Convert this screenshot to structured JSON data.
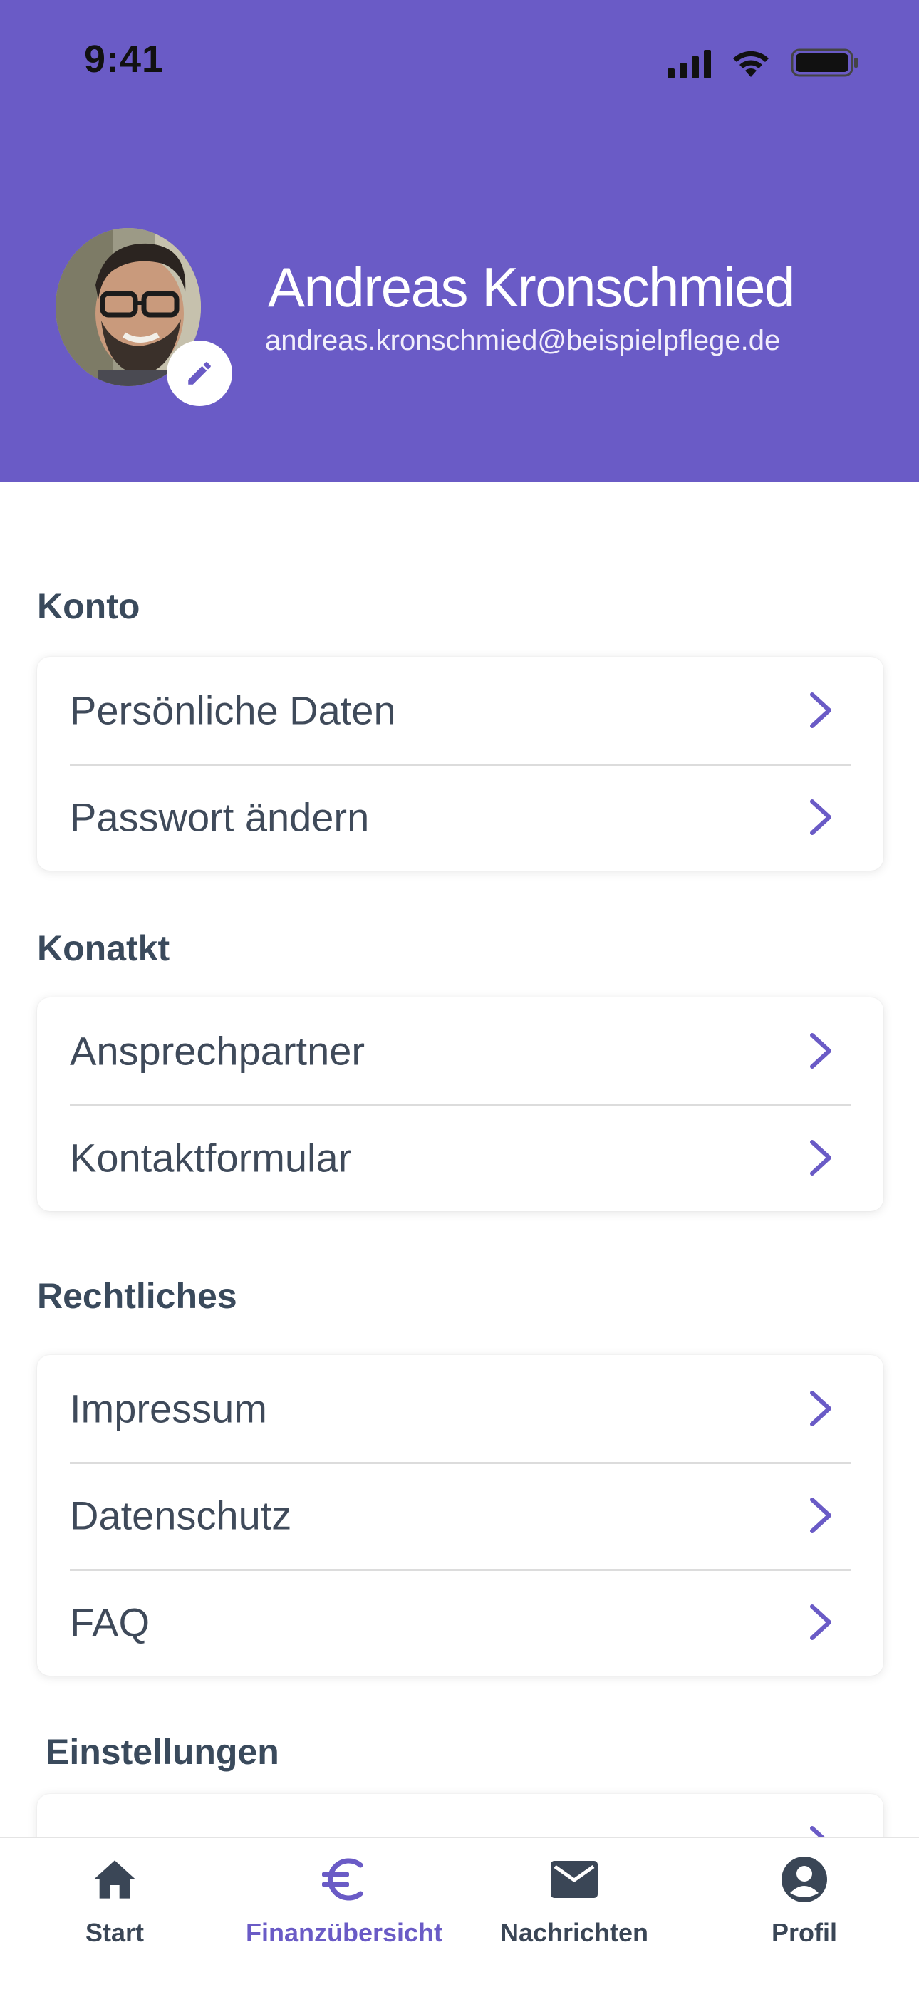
{
  "status_bar": {
    "time": "9:41"
  },
  "profile": {
    "name": "Andreas Kronschmied",
    "email": "andreas.kronschmied@beispielpflege.de"
  },
  "sections": [
    {
      "title": "Konto",
      "items": [
        "Persönliche Daten",
        "Passwort ändern"
      ]
    },
    {
      "title": "Konatkt",
      "items": [
        "Ansprechpartner",
        "Kontaktformular"
      ]
    },
    {
      "title": "Rechtliches",
      "items": [
        "Impressum",
        "Datenschutz",
        "FAQ"
      ]
    },
    {
      "title": "Einstellungen",
      "items": []
    }
  ],
  "tabs": [
    {
      "label": "Start",
      "icon": "home-icon"
    },
    {
      "label": "Finanzübersicht",
      "icon": "euro-icon",
      "active": true
    },
    {
      "label": "Nachrichten",
      "icon": "mail-icon"
    },
    {
      "label": "Profil",
      "icon": "profile-icon"
    }
  ],
  "colors": {
    "accent": "#6a5bc6",
    "text": "#3f4a5a",
    "section_title": "#3a4a5c"
  }
}
